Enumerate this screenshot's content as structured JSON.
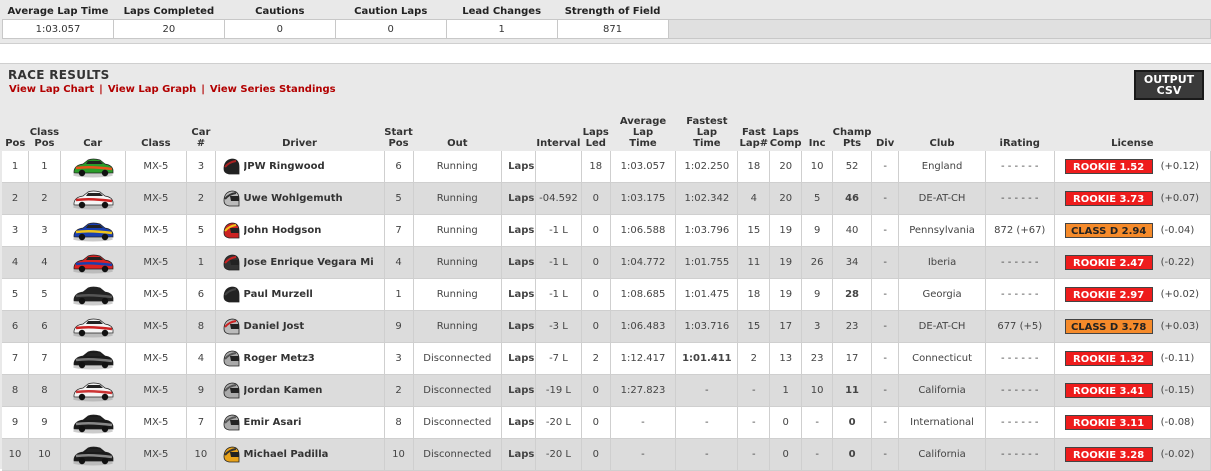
{
  "summary": {
    "headers": [
      "Average Lap Time",
      "Laps Completed",
      "Cautions",
      "Caution Laps",
      "Lead Changes",
      "Strength of Field"
    ],
    "values": [
      "1:03.057",
      "20",
      "0",
      "0",
      "1",
      "871"
    ]
  },
  "results": {
    "title": "RACE RESULTS",
    "links": [
      "View Lap Chart",
      "View Lap Graph",
      "View Series Standings"
    ],
    "csv_button": "OUTPUT CSV",
    "headers": [
      "Pos",
      "Class Pos",
      "Car",
      "Class",
      "Car #",
      "Driver",
      "Start Pos",
      "Out",
      "",
      "Interval",
      "Laps Led",
      "Average Lap Time",
      "Fastest Lap Time",
      "Fast Lap#",
      "Laps Comp",
      "Inc",
      "Champ Pts",
      "Div",
      "Club",
      "iRating",
      "License"
    ],
    "laps_label": "Laps",
    "rows": [
      {
        "pos": "1",
        "class_pos": "1",
        "car_colors": [
          "#2a9d2a",
          "#e8541a"
        ],
        "class": "MX-5",
        "car_num": "3",
        "driver": "JPW Ringwood",
        "helmet": [
          "#222222",
          "#aa2222"
        ],
        "start": "6",
        "out": "Running",
        "interval": "",
        "laps_led": "18",
        "avg": "1:03.057",
        "fastest": "1:02.250",
        "fast_lap": "18",
        "laps_comp": "20",
        "inc": "10",
        "champ": "52",
        "champ_hl": false,
        "div": "-",
        "club": "England",
        "irating": "- - - - - -",
        "license": "ROOKIE 1.52",
        "license_class": "rookie",
        "license_change": "(+0.12)",
        "fastest_hl": false
      },
      {
        "pos": "2",
        "class_pos": "2",
        "car_colors": [
          "#f4f4f4",
          "#cc2222"
        ],
        "class": "MX-5",
        "car_num": "2",
        "driver": "Uwe Wohlgemuth",
        "helmet": [
          "#bbbbbb",
          "#333333"
        ],
        "start": "5",
        "out": "Running",
        "interval": "-04.592",
        "laps_led": "0",
        "avg": "1:03.175",
        "fastest": "1:02.342",
        "fast_lap": "4",
        "laps_comp": "20",
        "inc": "5",
        "champ": "46",
        "champ_hl": true,
        "div": "-",
        "club": "DE-AT-CH",
        "irating": "- - - - - -",
        "license": "ROOKIE 3.73",
        "license_class": "rookie",
        "license_change": "(+0.07)",
        "fastest_hl": false
      },
      {
        "pos": "3",
        "class_pos": "3",
        "car_colors": [
          "#1a3fb0",
          "#f0c419"
        ],
        "class": "MX-5",
        "car_num": "5",
        "driver": "John Hodgson",
        "helmet": [
          "#cc2222",
          "#f0c419"
        ],
        "start": "7",
        "out": "Running",
        "interval": "-1 L",
        "laps_led": "0",
        "avg": "1:06.588",
        "fastest": "1:03.796",
        "fast_lap": "15",
        "laps_comp": "19",
        "inc": "9",
        "champ": "40",
        "champ_hl": false,
        "div": "-",
        "club": "Pennsylvania",
        "irating": "872 (+67)",
        "license": "CLASS D 2.94",
        "license_class": "classd",
        "license_change": "(-0.04)",
        "fastest_hl": false
      },
      {
        "pos": "4",
        "class_pos": "4",
        "car_colors": [
          "#dd2222",
          "#1a3fb0"
        ],
        "class": "MX-5",
        "car_num": "1",
        "driver": "Jose Enrique Vegara Mi",
        "helmet": [
          "#333333",
          "#cc2222"
        ],
        "start": "4",
        "out": "Running",
        "interval": "-1 L",
        "laps_led": "0",
        "avg": "1:04.772",
        "fastest": "1:01.755",
        "fast_lap": "11",
        "laps_comp": "19",
        "inc": "26",
        "champ": "34",
        "champ_hl": false,
        "div": "-",
        "club": "Iberia",
        "irating": "- - - - - -",
        "license": "ROOKIE 2.47",
        "license_class": "rookie",
        "license_change": "(-0.22)",
        "fastest_hl": false
      },
      {
        "pos": "5",
        "class_pos": "5",
        "car_colors": [
          "#222222",
          "#555555"
        ],
        "class": "MX-5",
        "car_num": "6",
        "driver": "Paul Murzell",
        "helmet": [
          "#222222",
          "#444444"
        ],
        "start": "1",
        "out": "Running",
        "interval": "-1 L",
        "laps_led": "0",
        "avg": "1:08.685",
        "fastest": "1:01.475",
        "fast_lap": "18",
        "laps_comp": "19",
        "inc": "9",
        "champ": "28",
        "champ_hl": true,
        "div": "-",
        "club": "Georgia",
        "irating": "- - - - - -",
        "license": "ROOKIE 2.97",
        "license_class": "rookie",
        "license_change": "(+0.02)",
        "fastest_hl": false
      },
      {
        "pos": "6",
        "class_pos": "6",
        "car_colors": [
          "#f4f4f4",
          "#cc2222"
        ],
        "class": "MX-5",
        "car_num": "8",
        "driver": "Daniel Jost",
        "helmet": [
          "#bbbbbb",
          "#cc2222"
        ],
        "start": "9",
        "out": "Running",
        "interval": "-3 L",
        "laps_led": "0",
        "avg": "1:06.483",
        "fastest": "1:03.716",
        "fast_lap": "15",
        "laps_comp": "17",
        "inc": "3",
        "champ": "23",
        "champ_hl": false,
        "div": "-",
        "club": "DE-AT-CH",
        "irating": "677 (+5)",
        "license": "CLASS D 3.78",
        "license_class": "classd",
        "license_change": "(+0.03)",
        "fastest_hl": false
      },
      {
        "pos": "7",
        "class_pos": "7",
        "car_colors": [
          "#1a1a1a",
          "#777777"
        ],
        "class": "MX-5",
        "car_num": "4",
        "driver": "Roger Metz3",
        "helmet": [
          "#aaaaaa",
          "#555555"
        ],
        "start": "3",
        "out": "Disconnected",
        "interval": "-7 L",
        "laps_led": "2",
        "avg": "1:12.417",
        "fastest": "1:01.411",
        "fast_lap": "2",
        "laps_comp": "13",
        "inc": "23",
        "champ": "17",
        "champ_hl": false,
        "div": "-",
        "club": "Connecticut",
        "irating": "- - - - - -",
        "license": "ROOKIE 1.32",
        "license_class": "rookie",
        "license_change": "(-0.11)",
        "fastest_hl": true
      },
      {
        "pos": "8",
        "class_pos": "8",
        "car_colors": [
          "#f4f4f4",
          "#cc3333"
        ],
        "class": "MX-5",
        "car_num": "9",
        "driver": "Jordan Kamen",
        "helmet": [
          "#aaaaaa",
          "#555555"
        ],
        "start": "2",
        "out": "Disconnected",
        "interval": "-19 L",
        "laps_led": "0",
        "avg": "1:27.823",
        "fastest": "-",
        "fast_lap": "-",
        "laps_comp": "1",
        "inc": "10",
        "champ": "11",
        "champ_hl": true,
        "div": "-",
        "club": "California",
        "irating": "- - - - - -",
        "license": "ROOKIE 3.41",
        "license_class": "rookie",
        "license_change": "(-0.15)",
        "fastest_hl": false
      },
      {
        "pos": "9",
        "class_pos": "9",
        "car_colors": [
          "#1a1a1a",
          "#888888"
        ],
        "class": "MX-5",
        "car_num": "7",
        "driver": "Emir Asari",
        "helmet": [
          "#aaaaaa",
          "#555555"
        ],
        "start": "8",
        "out": "Disconnected",
        "interval": "-20 L",
        "laps_led": "0",
        "avg": "-",
        "fastest": "-",
        "fast_lap": "-",
        "laps_comp": "0",
        "inc": "-",
        "champ": "0",
        "champ_hl": true,
        "div": "-",
        "club": "International",
        "irating": "- - - - - -",
        "license": "ROOKIE 3.11",
        "license_class": "rookie",
        "license_change": "(-0.08)",
        "fastest_hl": false
      },
      {
        "pos": "10",
        "class_pos": "10",
        "car_colors": [
          "#1a1a1a",
          "#888888"
        ],
        "class": "MX-5",
        "car_num": "10",
        "driver": "Michael Padilla",
        "helmet": [
          "#e8a21a",
          "#333333"
        ],
        "start": "10",
        "out": "Disconnected",
        "interval": "-20 L",
        "laps_led": "0",
        "avg": "-",
        "fastest": "-",
        "fast_lap": "-",
        "laps_comp": "0",
        "inc": "-",
        "champ": "0",
        "champ_hl": true,
        "div": "-",
        "club": "California",
        "irating": "- - - - - -",
        "license": "ROOKIE 3.28",
        "license_class": "rookie",
        "license_change": "(-0.02)",
        "fastest_hl": false
      }
    ]
  }
}
